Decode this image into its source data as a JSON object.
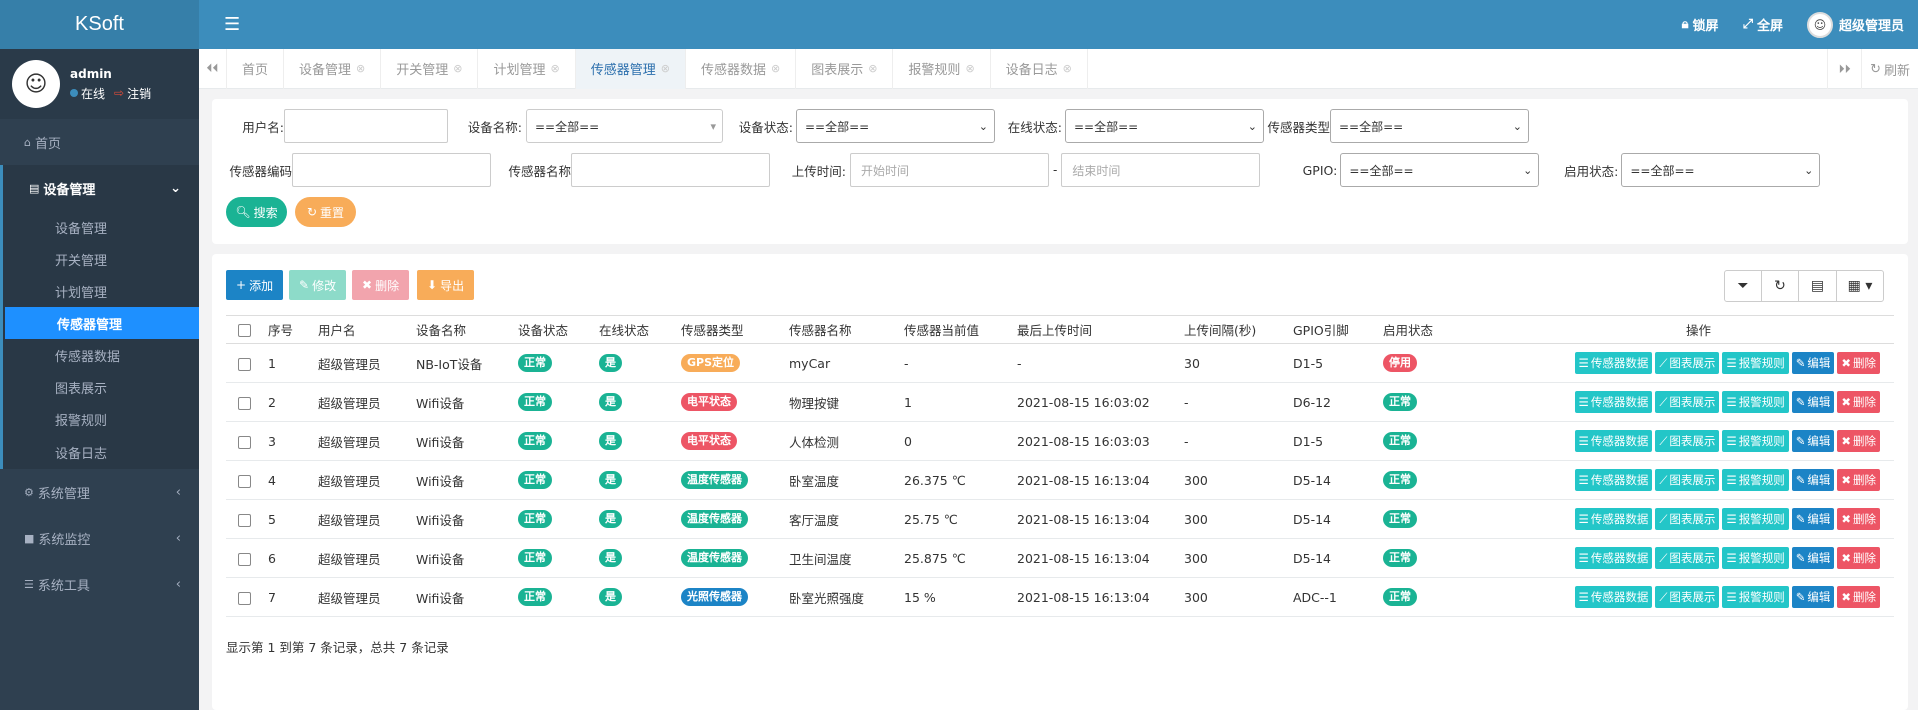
{
  "app": {
    "title": "KSoft"
  },
  "header": {
    "lock_label": "锁屏",
    "fullscreen_label": "全屏",
    "user_label": "超级管理员"
  },
  "sidebar": {
    "username": "admin",
    "status_online": "在线",
    "logout": "注销",
    "home": "首页",
    "device_group": "设备管理",
    "sub_items": [
      "设备管理",
      "开关管理",
      "计划管理",
      "传感器管理",
      "传感器数据",
      "图表展示",
      "报警规则",
      "设备日志"
    ],
    "active_index": 3,
    "system_mgmt": "系统管理",
    "system_monitor": "系统监控",
    "system_tools": "系统工具"
  },
  "tabs": {
    "items": [
      "首页",
      "设备管理",
      "开关管理",
      "计划管理",
      "传感器管理",
      "传感器数据",
      "图表展示",
      "报警规则",
      "设备日志"
    ],
    "active_index": 4,
    "refresh_label": "刷新"
  },
  "search": {
    "username_label": "用户名:",
    "device_name_label": "设备名称:",
    "device_name_value": "==全部==",
    "device_status_label": "设备状态:",
    "device_status_value": "==全部==",
    "online_status_label": "在线状态:",
    "online_status_value": "==全部==",
    "sensor_type_label": "传感器类型",
    "sensor_type_value": "==全部==",
    "sensor_code_label": "传感器编码",
    "sensor_name_label": "传感器名称",
    "upload_time_label": "上传时间:",
    "start_placeholder": "开始时间",
    "dash": "-",
    "end_placeholder": "结束时间",
    "gpio_label": "GPIO:",
    "gpio_value": "==全部==",
    "enable_label": "启用状态:",
    "enable_value": "==全部==",
    "search_btn": "搜索",
    "reset_btn": "重置"
  },
  "toolbar": {
    "add": "添加",
    "edit": "修改",
    "delete": "删除",
    "export": "导出"
  },
  "colors": {
    "teal": "#1ab394",
    "green_badge": "#1ab394",
    "orange": "#f8ac59",
    "red": "#ed5565",
    "blue": "#1c84c6",
    "cyan": "#23c6c8",
    "primary": "#1c84c6"
  },
  "table": {
    "headers": [
      "序号",
      "用户名",
      "设备名称",
      "设备状态",
      "在线状态",
      "传感器类型",
      "传感器名称",
      "传感器当前值",
      "最后上传时间",
      "上传间隔(秒)",
      "GPIO引脚",
      "启用状态",
      "操作"
    ],
    "rows": [
      {
        "no": "1",
        "user": "超级管理员",
        "device": "NB-IoT设备",
        "dev_status": "正常",
        "online": "是",
        "type": "GPS定位",
        "type_color": "#f8ac59",
        "name": "myCar",
        "value": "-",
        "time": "-",
        "interval": "30",
        "gpio": "D1-5",
        "enable": "停用",
        "enable_color": "#ed5565"
      },
      {
        "no": "2",
        "user": "超级管理员",
        "device": "Wifi设备",
        "dev_status": "正常",
        "online": "是",
        "type": "电平状态",
        "type_color": "#ed5565",
        "name": "物理按键",
        "value": "1",
        "time": "2021-08-15 16:03:02",
        "interval": "-",
        "gpio": "D6-12",
        "enable": "正常",
        "enable_color": "#1ab394"
      },
      {
        "no": "3",
        "user": "超级管理员",
        "device": "Wifi设备",
        "dev_status": "正常",
        "online": "是",
        "type": "电平状态",
        "type_color": "#ed5565",
        "name": "人体检测",
        "value": "0",
        "time": "2021-08-15 16:03:03",
        "interval": "-",
        "gpio": "D1-5",
        "enable": "正常",
        "enable_color": "#1ab394"
      },
      {
        "no": "4",
        "user": "超级管理员",
        "device": "Wifi设备",
        "dev_status": "正常",
        "online": "是",
        "type": "温度传感器",
        "type_color": "#1ab394",
        "name": "卧室温度",
        "value": "26.375 ℃",
        "time": "2021-08-15 16:13:04",
        "interval": "300",
        "gpio": "D5-14",
        "enable": "正常",
        "enable_color": "#1ab394"
      },
      {
        "no": "5",
        "user": "超级管理员",
        "device": "Wifi设备",
        "dev_status": "正常",
        "online": "是",
        "type": "温度传感器",
        "type_color": "#1ab394",
        "name": "客厅温度",
        "value": "25.75 ℃",
        "time": "2021-08-15 16:13:04",
        "interval": "300",
        "gpio": "D5-14",
        "enable": "正常",
        "enable_color": "#1ab394"
      },
      {
        "no": "6",
        "user": "超级管理员",
        "device": "Wifi设备",
        "dev_status": "正常",
        "online": "是",
        "type": "温度传感器",
        "type_color": "#1ab394",
        "name": "卫生间温度",
        "value": "25.875 ℃",
        "time": "2021-08-15 16:13:04",
        "interval": "300",
        "gpio": "D5-14",
        "enable": "正常",
        "enable_color": "#1ab394"
      },
      {
        "no": "7",
        "user": "超级管理员",
        "device": "Wifi设备",
        "dev_status": "正常",
        "online": "是",
        "type": "光照传感器",
        "type_color": "#1c84c6",
        "name": "卧室光照强度",
        "value": "15 %",
        "time": "2021-08-15 16:13:04",
        "interval": "300",
        "gpio": "ADC--1",
        "enable": "正常",
        "enable_color": "#1ab394"
      }
    ],
    "ops": {
      "sensor_data": "传感器数据",
      "chart": "图表展示",
      "alarm": "报警规则",
      "edit": "编辑",
      "delete": "删除"
    }
  },
  "pagination": {
    "text": "显示第 1 到第 7 条记录，总共 7 条记录"
  }
}
